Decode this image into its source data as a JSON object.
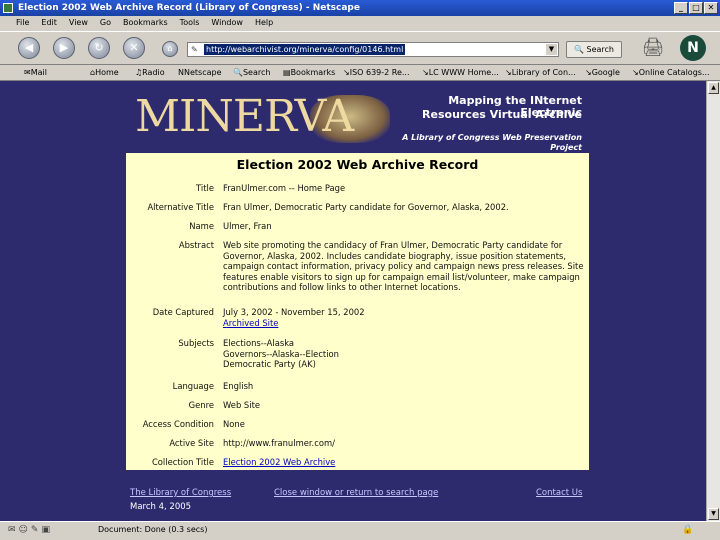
{
  "window": {
    "title": "Election 2002 Web Archive Record (Library of Congress) - Netscape"
  },
  "menu": [
    "File",
    "Edit",
    "View",
    "Go",
    "Bookmarks",
    "Tools",
    "Window",
    "Help"
  ],
  "nav": {
    "url": "http://webarchivist.org/minerva/config/0146.html",
    "search_label": "Search"
  },
  "bookmarks": [
    "Mail",
    "Home",
    "Radio",
    "Netscape",
    "Search",
    "Bookmarks",
    "ISO 639-2 Re...",
    "LC WWW Home...",
    "Library of Con...",
    "Google",
    "Online Catalogs..."
  ],
  "banner": {
    "logo": "MINERVA",
    "tagline1": "Mapping the INternet Electronic",
    "tagline2": "Resources Virtual Archive",
    "tagline3": "A Library of Congress Web Preservation Project"
  },
  "record": {
    "heading": "Election 2002 Web Archive Record",
    "title_label": "Title",
    "title": "FranUlmer.com -- Home Page",
    "alt_title_label": "Alternative Title",
    "alt_title": "Fran Ulmer, Democratic Party candidate for Governor, Alaska, 2002.",
    "name_label": "Name",
    "name": "Ulmer, Fran",
    "abstract_label": "Abstract",
    "abstract": "Web site promoting the candidacy of Fran Ulmer, Democratic Party candidate for Governor, Alaska, 2002. Includes candidate biography, issue position statements, campaign contact information, privacy policy and campaign news press releases. Site features enable visitors to sign up for campaign email list/volunteer, make campaign contributions and follow links to other Internet locations.",
    "date_label": "Date Captured",
    "date": "July 3, 2002 - November 15, 2002",
    "archived_link": "Archived Site",
    "subjects_label": "Subjects",
    "subject1": "Elections--Alaska",
    "subject2": "Governors--Alaska--Election",
    "subject3": "Democratic Party (AK)",
    "language_label": "Language",
    "language": "English",
    "genre_label": "Genre",
    "genre": "Web Site",
    "access_label": "Access Condition",
    "access": "None",
    "active_label": "Active Site",
    "active": "http://www.franulmer.com/",
    "collection_label": "Collection Title",
    "collection": "Election 2002 Web Archive"
  },
  "footer": {
    "loc": "The Library of Congress",
    "close": "Close window or return to search page",
    "contact": "Contact Us",
    "date": "March 4, 2005"
  },
  "status": {
    "text": "Document: Done (0.3 secs)"
  }
}
